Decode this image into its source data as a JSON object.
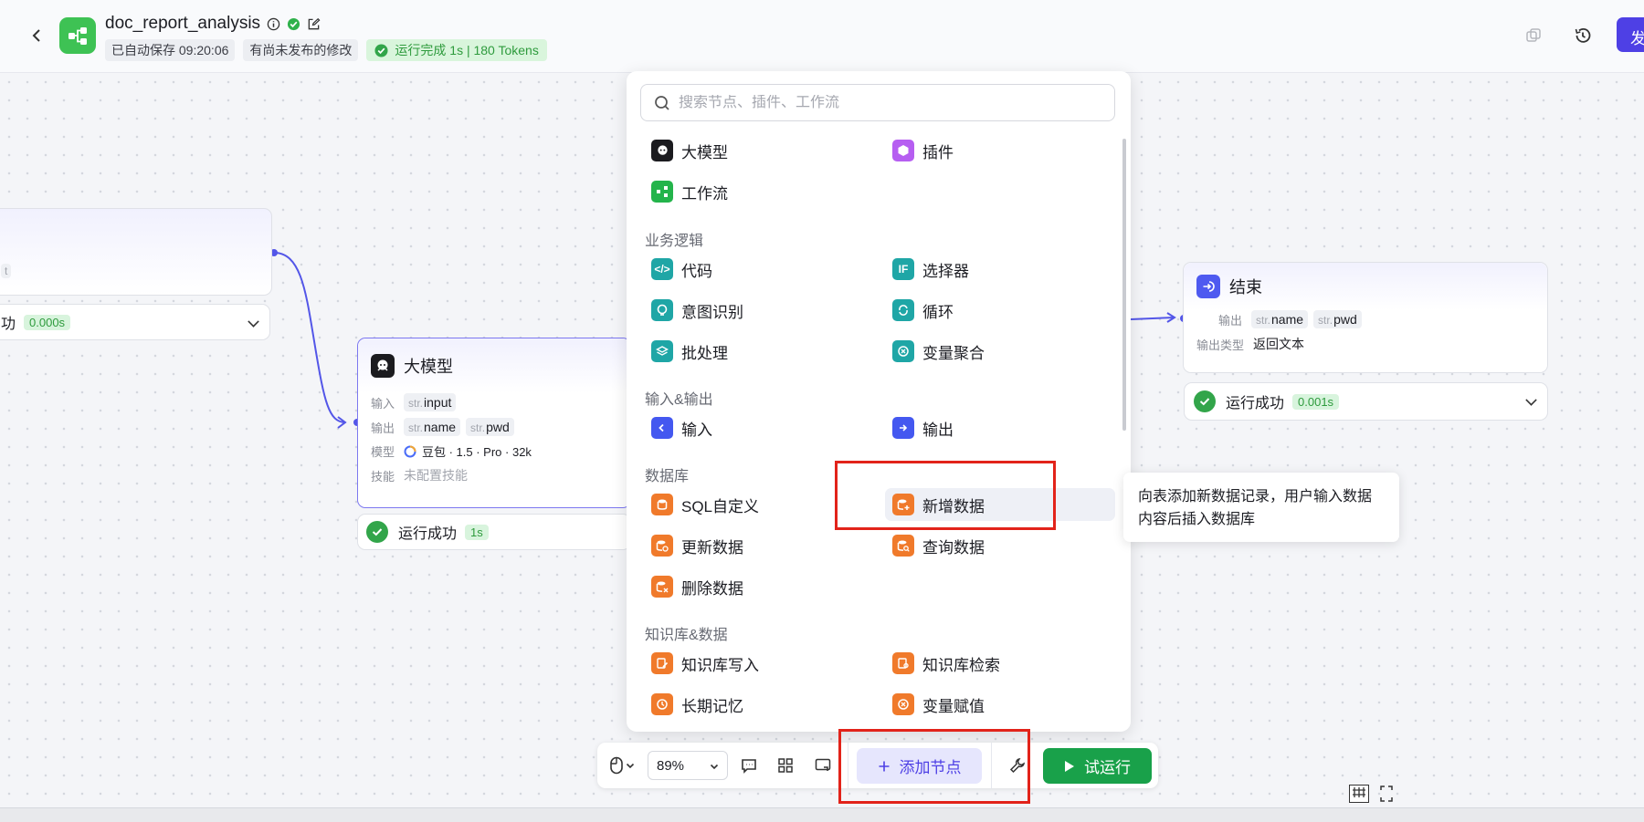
{
  "header": {
    "back_icon": "chevron-left-icon",
    "title": "doc_report_analysis",
    "autosave": "已自动保存 09:20:06",
    "unpublished": "有尚未发布的修改",
    "run_status": "运行完成 1s | 180 Tokens",
    "publish_label": "发"
  },
  "nodes": {
    "partial": {
      "row_value": "t",
      "status": "功",
      "time": "0.000s"
    },
    "llm": {
      "title": "大模型",
      "input_label": "输入",
      "input_var": "input",
      "output_label": "输出",
      "output_vars": [
        "name",
        "pwd"
      ],
      "model_label": "模型",
      "model_value": "豆包 · 1.5 · Pro · 32k",
      "skill_label": "技能",
      "skill_value": "未配置技能",
      "status": "运行成功",
      "time": "1s"
    },
    "end": {
      "title": "结束",
      "output_label": "输出",
      "output_vars": [
        "name",
        "pwd"
      ],
      "type_label": "输出类型",
      "type_value": "返回文本",
      "status": "运行成功",
      "time": "0.001s"
    }
  },
  "var_prefix": "str.",
  "panel": {
    "search_placeholder": "搜索节点、插件、工作流",
    "top": [
      "大模型",
      "插件",
      "工作流"
    ],
    "sections": {
      "logic": "业务逻辑",
      "io": "输入&输出",
      "db": "数据库",
      "kb": "知识库&数据"
    },
    "logic": [
      "代码",
      "选择器",
      "意图识别",
      "循环",
      "批处理",
      "变量聚合"
    ],
    "io": [
      "输入",
      "输出"
    ],
    "db": [
      "SQL自定义",
      "新增数据",
      "更新数据",
      "查询数据",
      "删除数据"
    ],
    "kb": [
      "知识库写入",
      "知识库检索",
      "长期记忆",
      "变量赋值"
    ]
  },
  "tooltip": "向表添加新数据记录，用户输入数据内容后插入数据库",
  "toolbar": {
    "zoom": "89%",
    "add_node": "添加节点",
    "run": "试运行"
  },
  "colors": {
    "accent": "#4e40e5",
    "success": "#32a54a",
    "highlight_box": "#e2231a"
  }
}
